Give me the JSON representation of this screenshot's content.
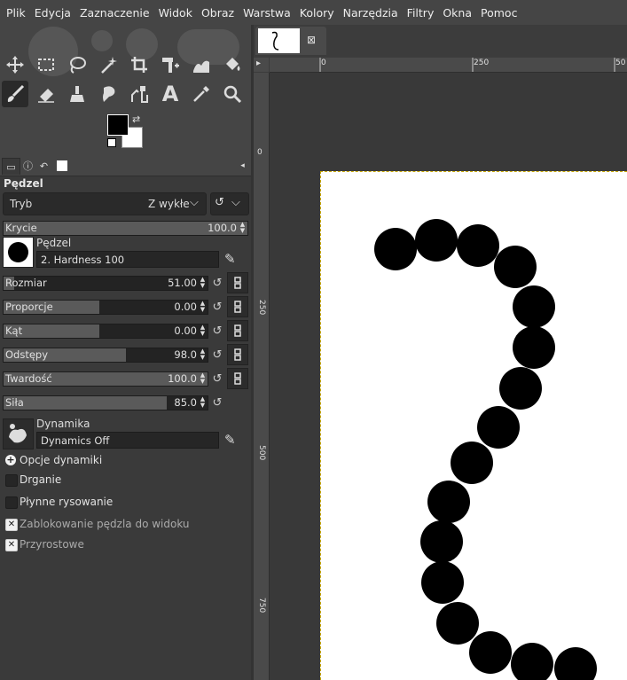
{
  "menu": [
    "Plik",
    "Edycja",
    "Zaznaczenie",
    "Widok",
    "Obraz",
    "Warstwa",
    "Kolory",
    "Narzędzia",
    "Filtry",
    "Okna",
    "Pomoc"
  ],
  "tools": [
    "move-tool",
    "rect-select-tool",
    "lasso-tool",
    "fuzzy-select-tool",
    "crop-tool",
    "unified-transform-tool",
    "warp-transform-tool",
    "bucket-fill-tool",
    "paintbrush-tool",
    "eraser-tool",
    "clone-tool",
    "smudge-tool",
    "dodge-burn-tool",
    "text-tool",
    "color-picker-tool",
    "zoom-tool"
  ],
  "colors": {
    "foreground": "#000000",
    "background": "#ffffff",
    "accent": "#c8a800"
  },
  "tool_options": {
    "title": "Pędzel",
    "mode_label": "Tryb",
    "mode_value": "Z wykłe",
    "opacity": {
      "label": "Krycie",
      "value": "100.0",
      "fraction": 1.0
    },
    "brush_label": "Pędzel",
    "brush_value": "2. Hardness 100",
    "sliders": [
      {
        "label": "Rozmiar",
        "value": "51.00",
        "fraction": 0.05
      },
      {
        "label": "Proporcje",
        "value": "0.00",
        "fraction": 0.5
      },
      {
        "label": "Kąt",
        "value": "0.00",
        "fraction": 0.5
      },
      {
        "label": "Odstępy",
        "value": "98.0",
        "fraction": 0.6
      },
      {
        "label": "Twardość",
        "value": "100.0",
        "fraction": 1.0
      },
      {
        "label": "Siła",
        "value": "85.0",
        "fraction": 0.85
      }
    ],
    "dynamics_label": "Dynamika",
    "dynamics_value": "Dynamics Off",
    "dynamics_options": "Opcje dynamiki",
    "checks": [
      {
        "label": "Drganie",
        "checked": false
      },
      {
        "label": "Płynne rysowanie",
        "checked": false
      },
      {
        "label": "Zablokowanie pędzla do widoku",
        "checked": true
      },
      {
        "label": "Przyrostowe",
        "checked": true
      }
    ]
  },
  "ruler": {
    "h_ticks": [
      "0",
      "250",
      "50"
    ],
    "v_ticks": [
      "0",
      "250",
      "500",
      "750"
    ]
  }
}
